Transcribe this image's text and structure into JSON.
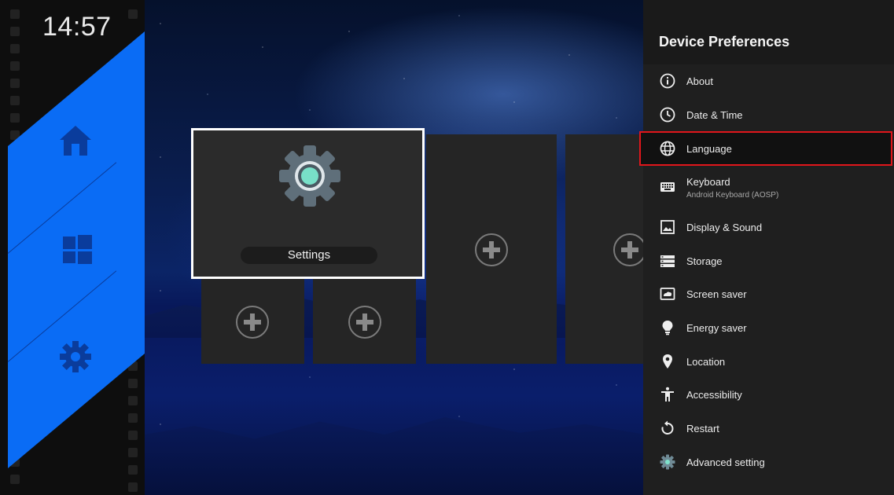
{
  "clock": "14:57",
  "launcher": {
    "nav": [
      {
        "icon": "home-icon"
      },
      {
        "icon": "apps-grid-icon"
      },
      {
        "icon": "gear-icon"
      }
    ],
    "tiles": {
      "focused_label": "Settings",
      "add_icon": "add-circle-icon"
    },
    "accent": "#0a6cf5"
  },
  "panel": {
    "title": "Device Preferences",
    "items": [
      {
        "label": "About",
        "icon": "info-icon"
      },
      {
        "label": "Date & Time",
        "icon": "clock-icon"
      },
      {
        "label": "Language",
        "icon": "globe-icon",
        "selected": true
      },
      {
        "label": "Keyboard",
        "sub": "Android Keyboard (AOSP)",
        "icon": "keyboard-icon"
      },
      {
        "label": "Display & Sound",
        "icon": "image-icon"
      },
      {
        "label": "Storage",
        "icon": "storage-icon"
      },
      {
        "label": "Screen saver",
        "icon": "screensaver-icon"
      },
      {
        "label": "Energy saver",
        "icon": "lightbulb-icon"
      },
      {
        "label": "Location",
        "icon": "location-pin-icon"
      },
      {
        "label": "Accessibility",
        "icon": "accessibility-icon"
      },
      {
        "label": "Restart",
        "icon": "restart-icon"
      },
      {
        "label": "Advanced setting",
        "icon": "gear-icon"
      }
    ],
    "highlight_color": "#e0161b"
  }
}
